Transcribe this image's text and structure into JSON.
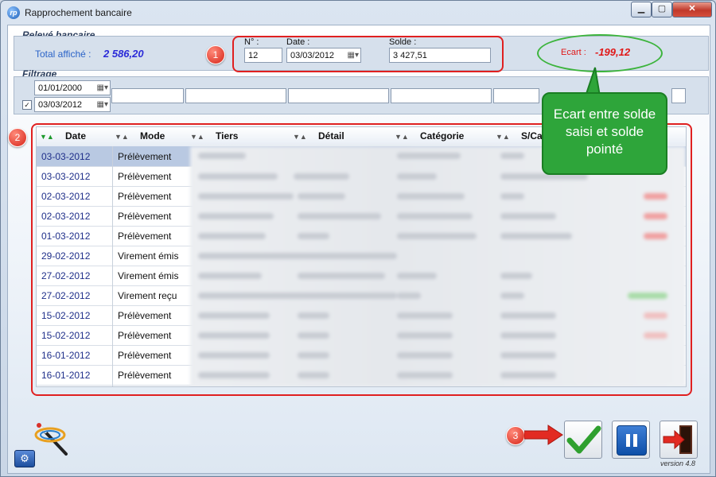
{
  "window": {
    "title": "Rapprochement bancaire",
    "app_icon": "rp",
    "min_glyph": "▁",
    "max_glyph": "▢",
    "close_glyph": "✕"
  },
  "releve": {
    "section_title": "Relevé bancaire",
    "total_label": "Total affiché :",
    "total_value": "2 586,20",
    "num_label": "N° :",
    "num_value": "12",
    "date_label": "Date :",
    "date_value": "03/03/2012",
    "solde_label": "Solde :",
    "solde_value": "3 427,51",
    "ecart_label": "Ecart :",
    "ecart_value": "-199,12"
  },
  "filtrage": {
    "section_title": "Filtrage",
    "date_from": "01/01/2000",
    "date_to": "03/03/2012",
    "date_to_checked": true,
    "checkbox_glyph": "✓"
  },
  "annotations": {
    "badge1": "1",
    "badge2": "2",
    "badge3": "3",
    "callout_text": "Ecart entre solde saisi et solde pointé"
  },
  "table": {
    "columns": [
      "Date",
      "Mode",
      "Tiers",
      "Détail",
      "Catégorie",
      "S/Ca"
    ],
    "rows": [
      {
        "date": "03-03-2012",
        "mode": "Prélèvement"
      },
      {
        "date": "03-03-2012",
        "mode": "Prélèvement"
      },
      {
        "date": "02-03-2012",
        "mode": "Prélèvement"
      },
      {
        "date": "02-03-2012",
        "mode": "Prélèvement"
      },
      {
        "date": "01-03-2012",
        "mode": "Prélèvement"
      },
      {
        "date": "29-02-2012",
        "mode": "Virement émis"
      },
      {
        "date": "27-02-2012",
        "mode": "Virement émis"
      },
      {
        "date": "27-02-2012",
        "mode": "Virement reçu"
      },
      {
        "date": "15-02-2012",
        "mode": "Prélèvement"
      },
      {
        "date": "15-02-2012",
        "mode": "Prélèvement"
      },
      {
        "date": "16-01-2012",
        "mode": "Prélèvement"
      },
      {
        "date": "16-01-2012",
        "mode": "Prélèvement"
      }
    ]
  },
  "footer": {
    "version": "version 4.8"
  },
  "colors": {
    "ecart": "#e01818",
    "total": "#2a2ad8",
    "badge": "#d62418",
    "callout": "#2ea53a"
  }
}
